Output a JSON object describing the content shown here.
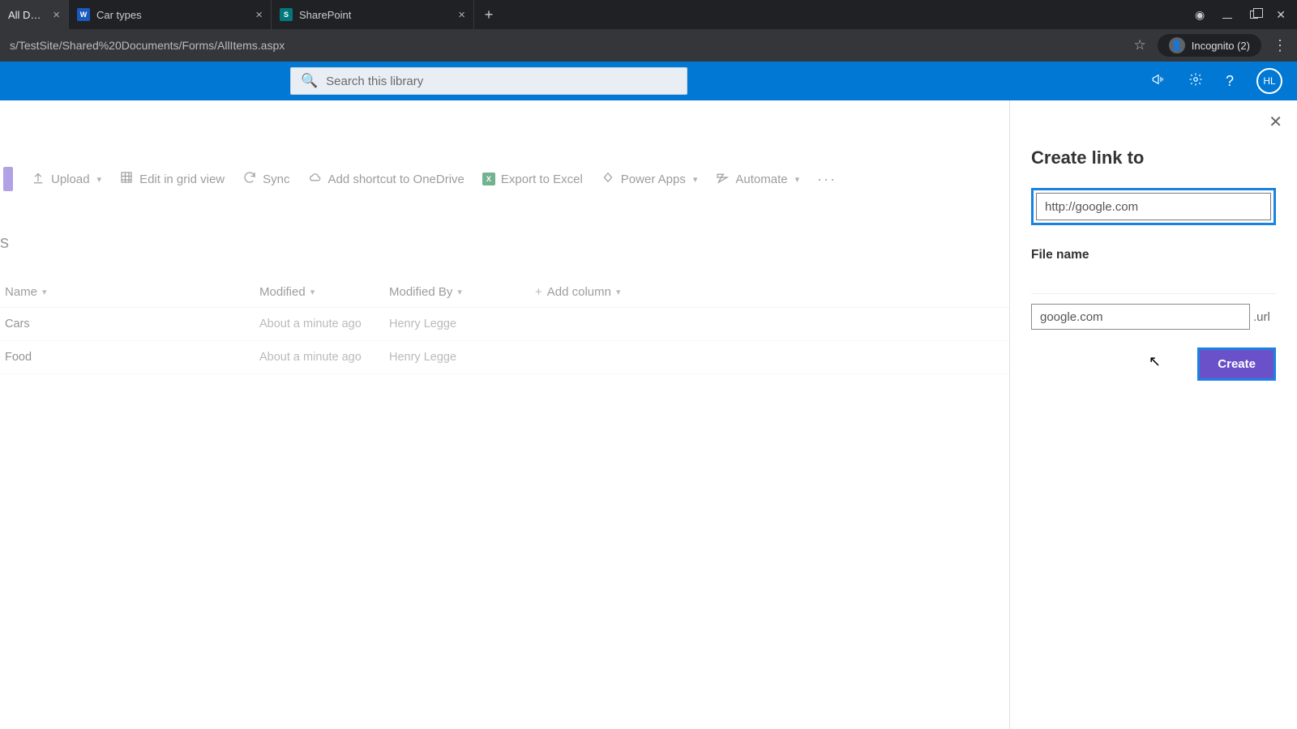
{
  "browser": {
    "tabs": [
      {
        "title": "All Docum",
        "active": true,
        "favicon": "sp"
      },
      {
        "title": "Car types",
        "active": false,
        "favicon": "word"
      },
      {
        "title": "SharePoint",
        "active": false,
        "favicon": "sp"
      }
    ],
    "url": "s/TestSite/Shared%20Documents/Forms/AllItems.aspx",
    "incognito_label": "Incognito (2)"
  },
  "header": {
    "search_placeholder": "Search this library",
    "avatar_initials": "HL"
  },
  "commands": {
    "upload": "Upload",
    "edit_grid": "Edit in grid view",
    "sync": "Sync",
    "onedrive": "Add shortcut to OneDrive",
    "export_excel": "Export to Excel",
    "power_apps": "Power Apps",
    "automate": "Automate"
  },
  "library": {
    "suffix_label": "s",
    "columns": {
      "name": "Name",
      "modified": "Modified",
      "modified_by": "Modified By",
      "add_column": "Add column"
    },
    "rows": [
      {
        "name": "Cars",
        "modified": "About a minute ago",
        "modified_by": "Henry Legge"
      },
      {
        "name": "Food",
        "modified": "About a minute ago",
        "modified_by": "Henry Legge"
      }
    ]
  },
  "panel": {
    "title": "Create link to",
    "link_value": "http://google.com",
    "filename_label": "File name",
    "filename_value": "google.com",
    "filename_ext": ".url",
    "create_label": "Create"
  }
}
